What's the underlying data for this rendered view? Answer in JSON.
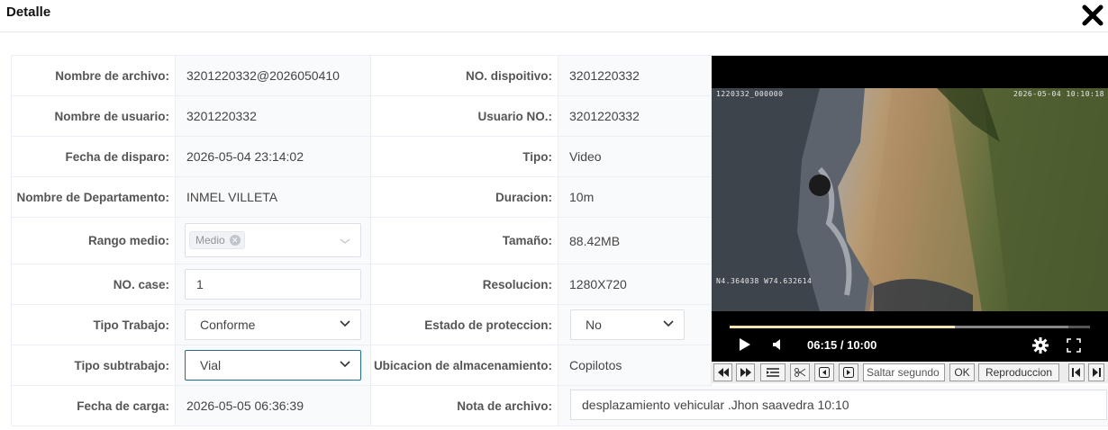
{
  "dialog": {
    "title": "Detalle"
  },
  "fields": {
    "nombre_archivo": {
      "label": "Nombre de archivo:",
      "value": "3201220332@2026050410"
    },
    "no_dispositivo": {
      "label": "NO. dispoitivo:",
      "value": "3201220332"
    },
    "nombre_usuario": {
      "label": "Nombre de usuario:",
      "value": "3201220332"
    },
    "usuario_no": {
      "label": "Usuario NO.:",
      "value": "3201220332"
    },
    "fecha_disparo": {
      "label": "Fecha de disparo:",
      "value": "2026-05-04 23:14:02"
    },
    "tipo": {
      "label": "Tipo:",
      "value": "Video"
    },
    "departamento": {
      "label": "Nombre de Departamento:",
      "value": "INMEL VILLETA"
    },
    "duracion": {
      "label": "Duracion:",
      "value": "10m"
    },
    "rango_medio": {
      "label": "Rango medio:",
      "tag": "Medio"
    },
    "tamano": {
      "label": "Tamaño:",
      "value": "88.42MB"
    },
    "no_case": {
      "label": "NO. case:",
      "value": "1"
    },
    "resolucion": {
      "label": "Resolucion:",
      "value": "1280X720"
    },
    "tipo_trabajo": {
      "label": "Tipo Trabajo:",
      "value": "Conforme"
    },
    "estado_proteccion": {
      "label": "Estado de proteccion:",
      "value": "No"
    },
    "tipo_subtrabajo": {
      "label": "Tipo subtrabajo:",
      "value": "Vial"
    },
    "ubicacion": {
      "label": "Ubicacion de almacenamiento:",
      "value": "Copilotos"
    },
    "fecha_carga": {
      "label": "Fecha de carga:",
      "value": "2026-05-05 06:36:39"
    },
    "nota": {
      "label": "Nota de archivo:",
      "value": "desplazamiento vehicular .Jhon saavedra 10:10"
    }
  },
  "video": {
    "osd_device": "1220332_000000",
    "osd_datetime": "2026-05-04 10:10:18",
    "osd_gps": "N4.364038 W74.632614",
    "time_display": "06:15 / 10:00",
    "progress_fraction": 0.625,
    "buffered_fraction": 0.94,
    "jump_placeholder": "Saltar segundo",
    "ok_label": "OK",
    "playback_label": "Reproduccion"
  },
  "icons": {
    "close": "close-icon",
    "play": "play-icon",
    "volume": "volume-icon",
    "settings": "gear-icon",
    "fullscreen": "fullscreen-icon"
  }
}
